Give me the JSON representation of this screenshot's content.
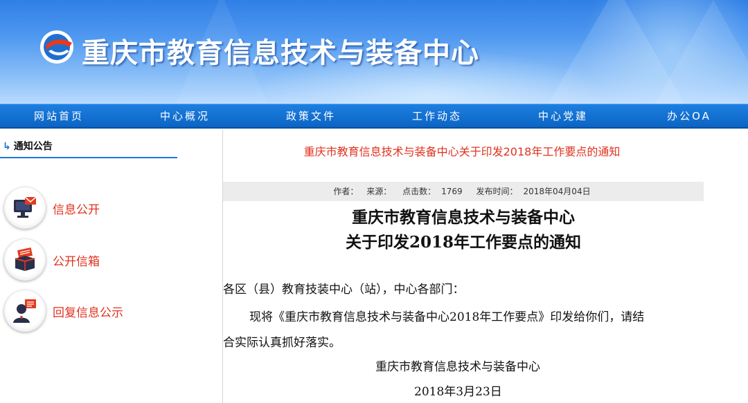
{
  "header": {
    "site_title": "重庆市教育信息技术与装备中心",
    "logo_icon": "site-logo-icon"
  },
  "nav": {
    "items": [
      {
        "label": "网站首页"
      },
      {
        "label": "中心概况"
      },
      {
        "label": "政策文件"
      },
      {
        "label": "工作动态"
      },
      {
        "label": "中心党建"
      },
      {
        "label": "办公OA"
      }
    ]
  },
  "sidebar": {
    "heading_arrow": "↳",
    "heading": "通知公告",
    "links": [
      {
        "label": "信息公开",
        "icon": "computer-mail-icon"
      },
      {
        "label": "公开信箱",
        "icon": "mailbox-icon"
      },
      {
        "label": "回复信息公示",
        "icon": "user-reply-icon"
      }
    ]
  },
  "article": {
    "link_title": "重庆市教育信息技术与装备中心关于印发2018年工作要点的通知",
    "meta": {
      "author_label": "作者：",
      "source_label": "来源：",
      "clicks_label": "点击数：",
      "clicks_value": "1769",
      "published_label": "发布时间：",
      "published_value": "2018年04月04日"
    },
    "title_line1": "重庆市教育信息技术与装备中心",
    "title_line2": "关于印发2018年工作要点的通知",
    "salutation": "各区（县）教育技装中心（站），中心各部门：",
    "body_line1": "现将《重庆市教育信息技术与装备中心2018年工作要点》印发给你们，请结",
    "body_line2": "合实际认真抓好落实。",
    "signature": "重庆市教育信息技术与装备中心",
    "date": "2018年3月23日"
  },
  "colors": {
    "nav_blue": "#0b64c4",
    "link_red": "#e0311e",
    "accent_blue": "#1e74d6"
  }
}
